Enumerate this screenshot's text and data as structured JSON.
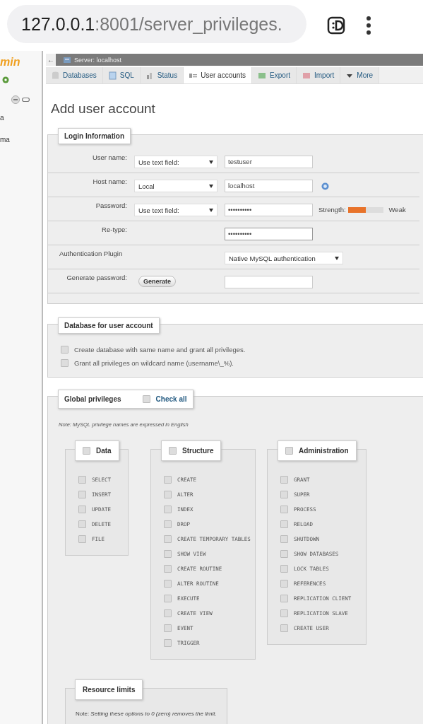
{
  "browser": {
    "url_host": "127.0.0.1",
    "url_rest": ":8001/server_privileges."
  },
  "sidebar": {
    "logo": "min",
    "items": [
      "a",
      "ma"
    ]
  },
  "breadcrumb": {
    "back": "←",
    "server": "Server: localhost"
  },
  "tabs": [
    {
      "label": "Databases",
      "selected": false
    },
    {
      "label": "SQL",
      "selected": false
    },
    {
      "label": "Status",
      "selected": false
    },
    {
      "label": "User accounts",
      "selected": true
    },
    {
      "label": "Export",
      "selected": false
    },
    {
      "label": "Import",
      "selected": false
    },
    {
      "label": "More",
      "selected": false
    }
  ],
  "page_title": "Add user account",
  "login": {
    "legend": "Login Information",
    "rows": [
      {
        "kind": "select_input",
        "label": "User name:",
        "select": "Use text field:",
        "value": "testuser",
        "help": false
      },
      {
        "kind": "select_input",
        "label": "Host name:",
        "select": "Local",
        "value": "localhost",
        "help": true
      },
      {
        "kind": "password",
        "label": "Password:",
        "select": "Use text field:",
        "value": "••••••••••",
        "strength_label": "Strength:",
        "level": 0.5,
        "strength": "Weak"
      },
      {
        "kind": "retype",
        "label": "Re-type:",
        "value": "••••••••••"
      },
      {
        "kind": "plugin",
        "label": "Authentication Plugin",
        "select": "Native MySQL authentication"
      },
      {
        "kind": "generate",
        "label": "Generate password:",
        "button": "Generate"
      }
    ]
  },
  "database": {
    "legend": "Database for user account",
    "options": [
      {
        "label": "Create database with same name and grant all privileges.",
        "checked": false
      },
      {
        "label": "Grant all privileges on wildcard name (username\\_%).",
        "checked": false
      }
    ]
  },
  "global": {
    "legend": "Global privileges",
    "check_all": {
      "label": "Check all",
      "checked": false
    },
    "note": "Note: MySQL privilege names are expressed in English",
    "groups": [
      {
        "legend": "Data",
        "checked": false,
        "items": [
          {
            "label": "SELECT",
            "checked": false
          },
          {
            "label": "INSERT",
            "checked": false
          },
          {
            "label": "UPDATE",
            "checked": false
          },
          {
            "label": "DELETE",
            "checked": false
          },
          {
            "label": "FILE",
            "checked": false
          }
        ]
      },
      {
        "legend": "Structure",
        "checked": false,
        "items": [
          {
            "label": "CREATE",
            "checked": false
          },
          {
            "label": "ALTER",
            "checked": false
          },
          {
            "label": "INDEX",
            "checked": false
          },
          {
            "label": "DROP",
            "checked": false
          },
          {
            "label": "CREATE TEMPORARY TABLES",
            "checked": false
          },
          {
            "label": "SHOW VIEW",
            "checked": false
          },
          {
            "label": "CREATE ROUTINE",
            "checked": false
          },
          {
            "label": "ALTER ROUTINE",
            "checked": false
          },
          {
            "label": "EXECUTE",
            "checked": false
          },
          {
            "label": "CREATE VIEW",
            "checked": false
          },
          {
            "label": "EVENT",
            "checked": false
          },
          {
            "label": "TRIGGER",
            "checked": false
          }
        ]
      },
      {
        "legend": "Administration",
        "checked": false,
        "items": [
          {
            "label": "GRANT",
            "checked": false
          },
          {
            "label": "SUPER",
            "checked": false
          },
          {
            "label": "PROCESS",
            "checked": false
          },
          {
            "label": "RELOAD",
            "checked": false
          },
          {
            "label": "SHUTDOWN",
            "checked": false
          },
          {
            "label": "SHOW DATABASES",
            "checked": false
          },
          {
            "label": "LOCK TABLES",
            "checked": false
          },
          {
            "label": "REFERENCES",
            "checked": false
          },
          {
            "label": "REPLICATION CLIENT",
            "checked": false
          },
          {
            "label": "REPLICATION SLAVE",
            "checked": false
          },
          {
            "label": "CREATE USER",
            "checked": false
          }
        ]
      }
    ]
  },
  "resource": {
    "legend": "Resource limits",
    "note": "Note: *Setting these options to 0 (zero) removes the limit.*"
  }
}
